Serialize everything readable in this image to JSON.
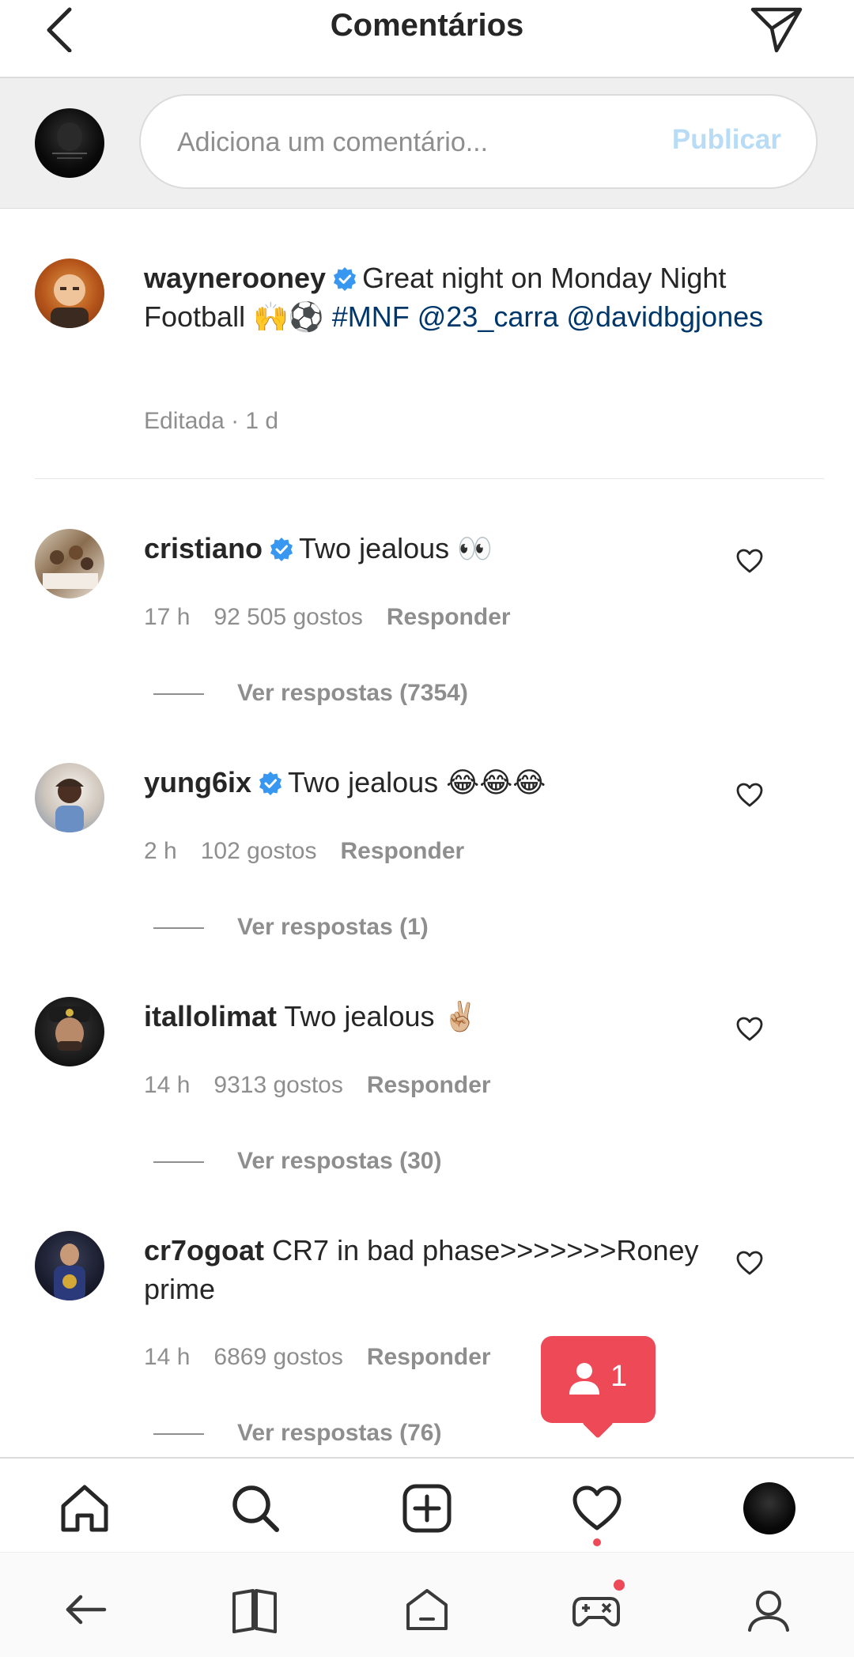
{
  "header": {
    "title": "Comentários",
    "back_icon": "chevron-left-icon",
    "send_icon": "paper-plane-icon"
  },
  "composer": {
    "placeholder": "Adiciona um comentário...",
    "value": "",
    "publish_label": "Publicar",
    "publish_color": "#b8dcf5"
  },
  "caption": {
    "username": "waynerooney",
    "text_main": "Great night on Monday Night Football 🙌⚽ ",
    "hashtag": "#MNF",
    "mention1": "@23_carra",
    "mention2": "@davidbgjones",
    "meta": "Editada · 1 d"
  },
  "comments": [
    {
      "username": "cristiano",
      "verified": true,
      "text": "Two jealous 👀",
      "time": "17 h",
      "likes": "92 505 gostos",
      "reply_label": "Responder",
      "view_replies": "Ver respostas (7354)"
    },
    {
      "username": "yung6ix",
      "verified": true,
      "text": "Two jealous 😂😂😂",
      "time": "2 h",
      "likes": "102 gostos",
      "reply_label": "Responder",
      "view_replies": "Ver respostas (1)"
    },
    {
      "username": "itallolimat",
      "verified": false,
      "text": "Two jealous ✌🏼",
      "time": "14 h",
      "likes": "9313 gostos",
      "reply_label": "Responder",
      "view_replies": "Ver respostas (30)"
    },
    {
      "username": "cr7ogoat",
      "verified": false,
      "text": "CR7 in bad phase>>>>>>>Roney prime",
      "time": "14 h",
      "likes": "6869 gostos",
      "reply_label": "Responder",
      "view_replies": "Ver respostas (76)"
    }
  ],
  "toast": {
    "count": "1",
    "color": "#ed4956",
    "icon": "person-icon"
  },
  "tabbar": {
    "items": [
      "home-icon",
      "search-icon",
      "new-post-icon",
      "activity-heart-icon",
      "profile-avatar"
    ],
    "notification_color": "#ed4956"
  },
  "system_nav": {
    "items": [
      "back-arrow-icon",
      "book-icon",
      "home-icon",
      "game-controller-icon",
      "user-icon"
    ]
  },
  "colors": {
    "text": "#262626",
    "secondary": "#8e8e8e",
    "link": "#00376b",
    "verified": "#3897f0"
  }
}
